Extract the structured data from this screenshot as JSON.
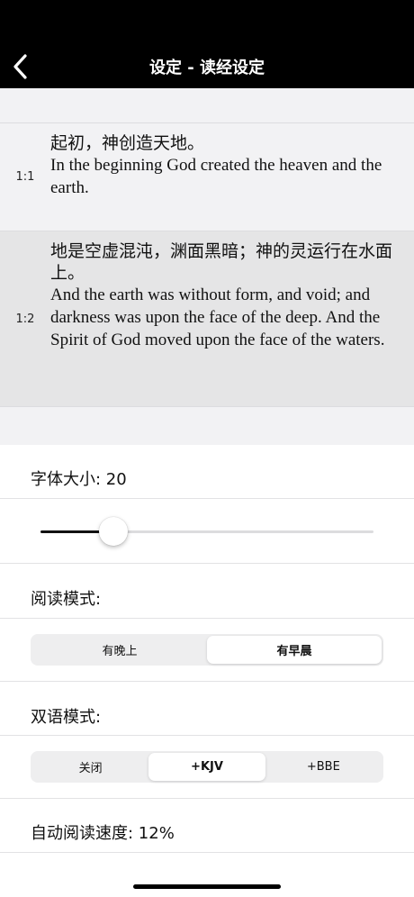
{
  "nav": {
    "title": "设定 - 读经设定",
    "back_icon": "chevron-left-icon"
  },
  "preview": {
    "verses": [
      {
        "ref": "1:1",
        "zh": "起初，神创造天地。",
        "en": "In the beginning God created the heaven and the earth."
      },
      {
        "ref": "1:2",
        "zh": "地是空虚混沌，渊面黑暗；神的灵运行在水面上。",
        "en": "And the earth was without form, and void; and darkness was upon the face of the deep. And the Spirit of God moved upon the face of the waters."
      }
    ]
  },
  "settings": {
    "font_size_label": "字体大小: 20",
    "font_size_level": 0.22,
    "reading_mode_label": "阅读模式:",
    "reading_mode_options": [
      "有晚上",
      "有早晨"
    ],
    "reading_mode_selected": "有早晨",
    "bilingual_label": "双语模式:",
    "bilingual_options": [
      "关闭",
      "+KJV",
      "+BBE"
    ],
    "bilingual_selected": "+KJV",
    "auto_speed_label": "自动阅读速度: 12%"
  },
  "colors": {
    "nav_bg": "#000000",
    "preview_bg": "#f2f2f4",
    "highlight_bg": "#e5e5e6"
  }
}
